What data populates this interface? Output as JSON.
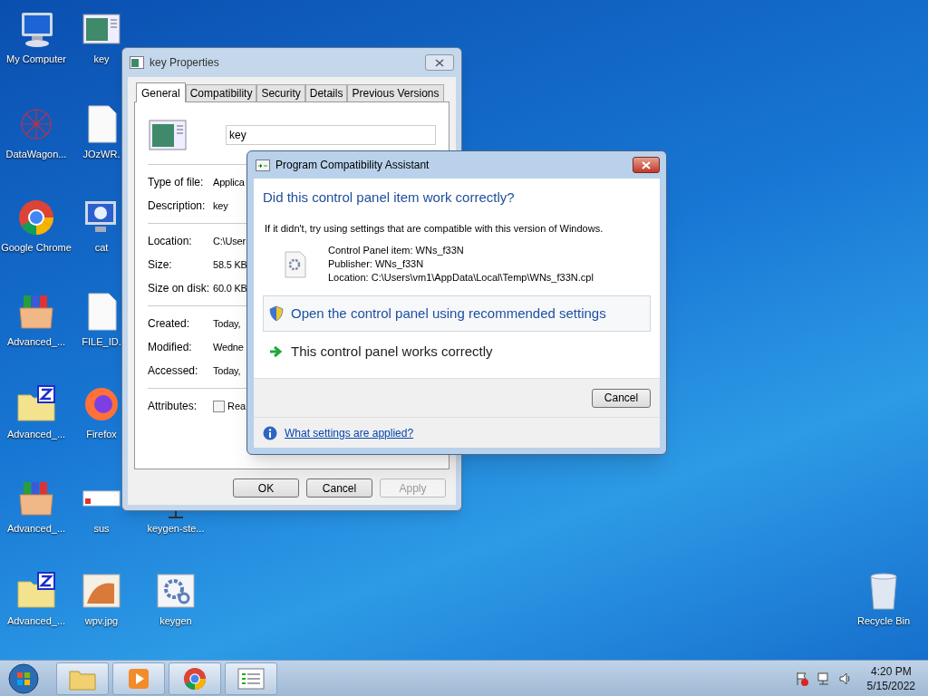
{
  "desktop_icons": [
    {
      "label": "My Computer",
      "kind": "computer"
    },
    {
      "label": "DataWagon...",
      "kind": "network"
    },
    {
      "label": "Google Chrome",
      "kind": "chrome"
    },
    {
      "label": "Advanced_...",
      "kind": "archive"
    },
    {
      "label": "Advanced_...",
      "kind": "zipfolder"
    },
    {
      "label": "Advanced_...",
      "kind": "archive"
    },
    {
      "label": "Advanced_...",
      "kind": "zipfolder"
    },
    {
      "label": "key",
      "kind": "appwindow"
    },
    {
      "label": "JOzWR.",
      "kind": "file"
    },
    {
      "label": "cat",
      "kind": "infomonitor"
    },
    {
      "label": "FILE_ID.",
      "kind": "file"
    },
    {
      "label": "Firefox",
      "kind": "firefox"
    },
    {
      "label": "sus",
      "kind": "screenshot"
    },
    {
      "label": "wpv.jpg",
      "kind": "image"
    },
    {
      "label": "keygen-ste...",
      "kind": "monitor"
    },
    {
      "label": "keygen",
      "kind": "gear"
    },
    {
      "label": "Recycle Bin",
      "kind": "recycle"
    }
  ],
  "properties_window": {
    "title": "key Properties",
    "tabs": [
      {
        "label": "General",
        "selected": true
      },
      {
        "label": "Compatibility",
        "selected": false
      },
      {
        "label": "Security",
        "selected": false
      },
      {
        "label": "Details",
        "selected": false
      },
      {
        "label": "Previous Versions",
        "selected": false
      }
    ],
    "name_value": "key",
    "groups": [
      [
        {
          "label": "Type of file:",
          "value": "Applica"
        },
        {
          "label": "Description:",
          "value": "key"
        }
      ],
      [
        {
          "label": "Location:",
          "value": "C:\\User"
        },
        {
          "label": "Size:",
          "value": "58.5 KB"
        },
        {
          "label": "Size on disk:",
          "value": "60.0 KB"
        }
      ],
      [
        {
          "label": "Created:",
          "value": "Today,"
        },
        {
          "label": "Modified:",
          "value": "Wedne"
        },
        {
          "label": "Accessed:",
          "value": "Today,"
        }
      ]
    ],
    "attributes_label": "Attributes:",
    "readonly": {
      "label": "Rea",
      "checked": false
    },
    "buttons": [
      {
        "label": "OK",
        "disabled": false
      },
      {
        "label": "Cancel",
        "disabled": false
      },
      {
        "label": "Apply",
        "disabled": true
      }
    ]
  },
  "pca_dialog": {
    "title": "Program Compatibility Assistant",
    "heading": "Did this control panel item work correctly?",
    "message": "If it didn't, try using settings that are compatible with this version of Windows.",
    "details": [
      "Control Panel item: WNs_f33N",
      "Publisher: WNs_f33N",
      "Location: C:\\Users\\vm1\\AppData\\Local\\Temp\\WNs_f33N.cpl"
    ],
    "options": [
      {
        "label": "Open the control panel using recommended settings",
        "kind": "shield",
        "highlighted": true
      },
      {
        "label": "This control panel works correctly",
        "kind": "arrow",
        "highlighted": false
      }
    ],
    "cancel": "Cancel",
    "link": "What settings are applied?"
  },
  "taskbar": {
    "items": [
      {
        "kind": "explorer"
      },
      {
        "kind": "media"
      },
      {
        "kind": "chrome"
      },
      {
        "kind": "list"
      }
    ],
    "time": "4:20 PM",
    "date": "5/15/2022"
  }
}
